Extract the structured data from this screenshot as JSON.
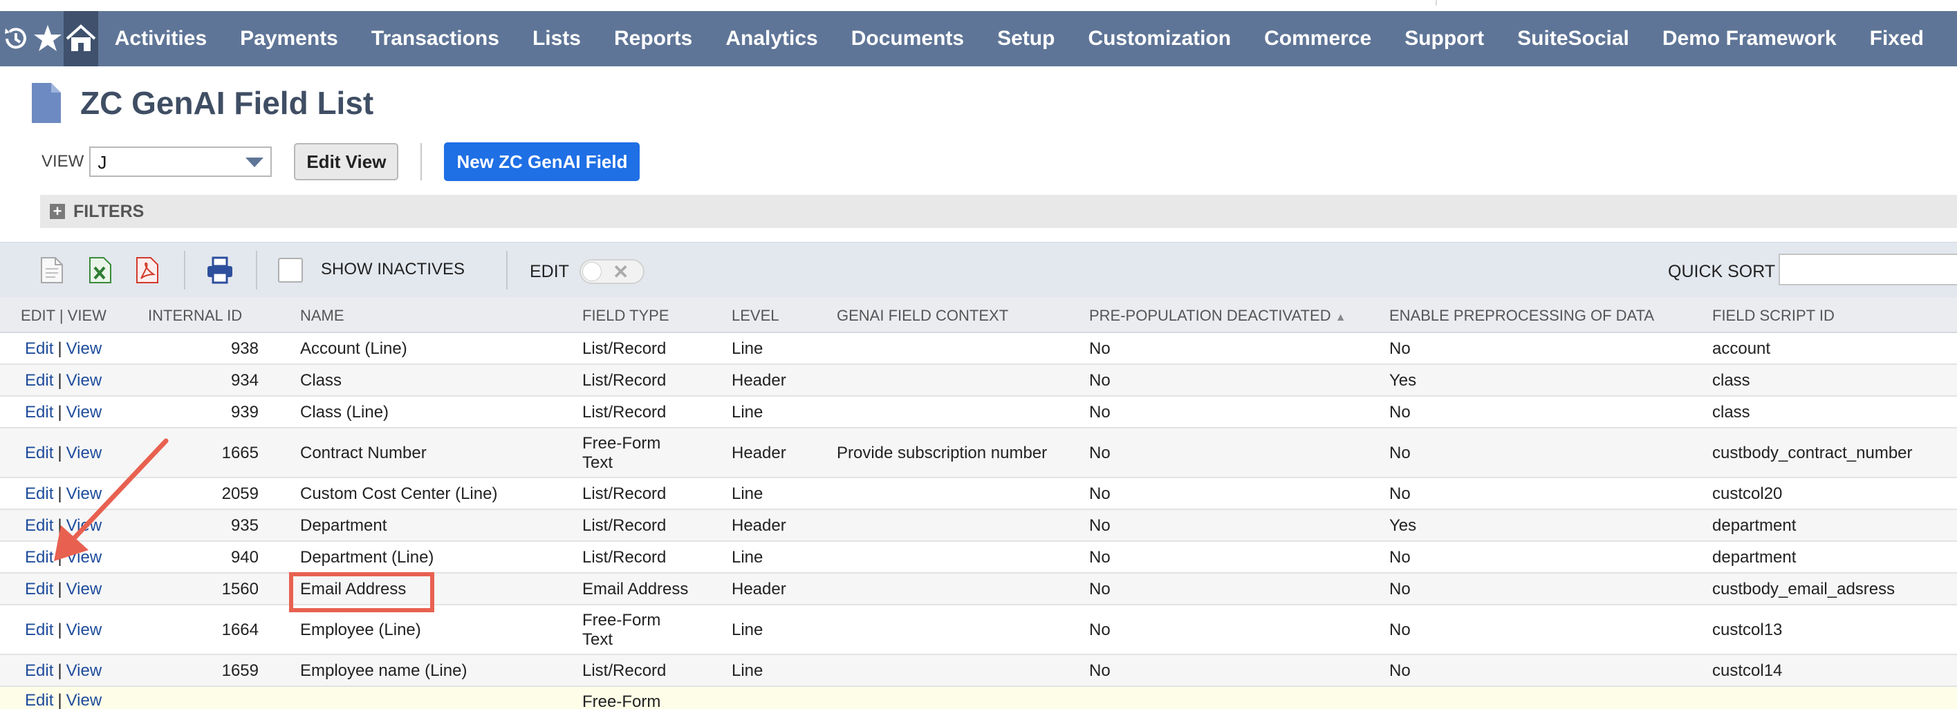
{
  "nav": {
    "items": [
      "Activities",
      "Payments",
      "Transactions",
      "Lists",
      "Reports",
      "Analytics",
      "Documents",
      "Setup",
      "Customization",
      "Commerce",
      "Support",
      "SuiteSocial",
      "Demo Framework",
      "Fixed"
    ],
    "icons": [
      "recent-icon",
      "star-icon",
      "home-icon"
    ]
  },
  "page": {
    "title": "ZC GenAI Field List"
  },
  "view": {
    "label": "VIEW",
    "selected": "J",
    "edit_view_label": "Edit View",
    "new_button_label": "New ZC GenAI Field"
  },
  "filters": {
    "label": "FILTERS"
  },
  "toolbar": {
    "show_inactives_label": "SHOW INACTIVES",
    "edit_label": "EDIT",
    "quick_sort_label": "QUICK SORT"
  },
  "table": {
    "headers": {
      "edit_view": "EDIT | VIEW",
      "internal_id": "INTERNAL ID",
      "name": "NAME",
      "field_type": "FIELD TYPE",
      "level": "LEVEL",
      "genai_context": "GENAI FIELD CONTEXT",
      "prepop": "PRE-POPULATION DEACTIVATED",
      "prepop_sort": "▲",
      "enable_preproc": "ENABLE PREPROCESSING OF DATA",
      "script_id": "FIELD SCRIPT ID"
    },
    "edit_link": "Edit",
    "pipe": "|",
    "view_link": "View",
    "rows": [
      {
        "id": "938",
        "name": "Account (Line)",
        "type": "List/Record",
        "level": "Line",
        "context": "",
        "prepop": "No",
        "preproc": "No",
        "script": "account"
      },
      {
        "id": "934",
        "name": "Class",
        "type": "List/Record",
        "level": "Header",
        "context": "",
        "prepop": "No",
        "preproc": "Yes",
        "script": "class"
      },
      {
        "id": "939",
        "name": "Class (Line)",
        "type": "List/Record",
        "level": "Line",
        "context": "",
        "prepop": "No",
        "preproc": "No",
        "script": "class"
      },
      {
        "id": "1665",
        "name": "Contract Number",
        "type": "Free-Form Text",
        "level": "Header",
        "context": "Provide subscription number",
        "prepop": "No",
        "preproc": "No",
        "script": "custbody_contract_number"
      },
      {
        "id": "2059",
        "name": "Custom Cost Center (Line)",
        "type": "List/Record",
        "level": "Line",
        "context": "",
        "prepop": "No",
        "preproc": "No",
        "script": "custcol20"
      },
      {
        "id": "935",
        "name": "Department",
        "type": "List/Record",
        "level": "Header",
        "context": "",
        "prepop": "No",
        "preproc": "Yes",
        "script": "department"
      },
      {
        "id": "940",
        "name": "Department (Line)",
        "type": "List/Record",
        "level": "Line",
        "context": "",
        "prepop": "No",
        "preproc": "No",
        "script": "department"
      },
      {
        "id": "1560",
        "name": "Email Address",
        "type": "Email Address",
        "level": "Header",
        "context": "",
        "prepop": "No",
        "preproc": "No",
        "script": "custbody_email_adsress"
      },
      {
        "id": "1664",
        "name": "Employee (Line)",
        "type": "Free-Form Text",
        "level": "Line",
        "context": "",
        "prepop": "No",
        "preproc": "No",
        "script": "custcol13"
      },
      {
        "id": "1659",
        "name": "Employee name (Line)",
        "type": "List/Record",
        "level": "Line",
        "context": "",
        "prepop": "No",
        "preproc": "No",
        "script": "custcol14"
      },
      {
        "id": "",
        "name": "",
        "type": "Free-Form",
        "level": "",
        "context": "",
        "prepop": "",
        "preproc": "",
        "script": ""
      }
    ]
  },
  "colors": {
    "nav_bg": "#5f7597",
    "nav_home_bg": "#3f516d",
    "primary_button": "#1f6fe5",
    "link": "#1e4c9b",
    "annotation": "#e86150"
  }
}
